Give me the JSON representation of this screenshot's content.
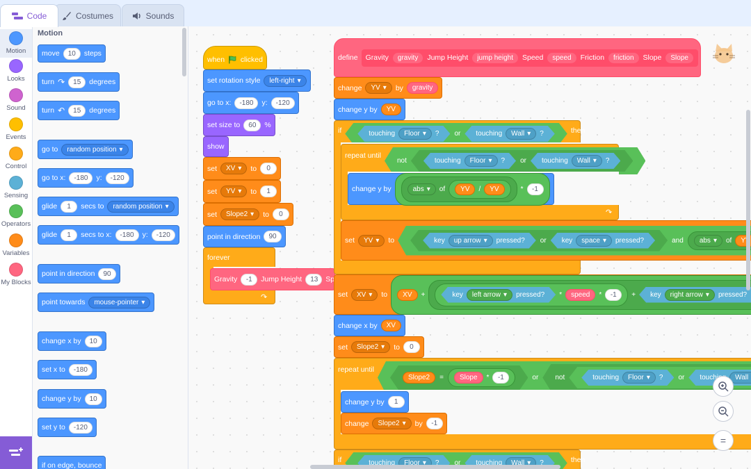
{
  "tabs": [
    {
      "label": "Code",
      "icon": "code-icon",
      "active": true
    },
    {
      "label": "Costumes",
      "icon": "brush-icon",
      "active": false
    },
    {
      "label": "Sounds",
      "icon": "speaker-icon",
      "active": false
    }
  ],
  "categories": [
    {
      "label": "Motion",
      "color": "#4c97ff"
    },
    {
      "label": "Looks",
      "color": "#9966ff"
    },
    {
      "label": "Sound",
      "color": "#cf63cf"
    },
    {
      "label": "Events",
      "color": "#ffbf00"
    },
    {
      "label": "Control",
      "color": "#ffab19"
    },
    {
      "label": "Sensing",
      "color": "#5cb1d6"
    },
    {
      "label": "Operators",
      "color": "#59c059"
    },
    {
      "label": "Variables",
      "color": "#ff8c1a"
    },
    {
      "label": "My Blocks",
      "color": "#ff6680"
    }
  ],
  "palette": {
    "title": "Motion",
    "move": {
      "a": "move",
      "v": "10",
      "b": "steps"
    },
    "turn_right": {
      "a": "turn",
      "v": "15",
      "b": "degrees"
    },
    "turn_left": {
      "a": "turn",
      "v": "15",
      "b": "degrees"
    },
    "goto": {
      "a": "go to",
      "dd": "random position"
    },
    "goto_xy": {
      "a": "go to x:",
      "x": "-180",
      "b": "y:",
      "y": "-120"
    },
    "glide_to": {
      "a": "glide",
      "v": "1",
      "b": "secs to",
      "dd": "random position"
    },
    "glide_xy": {
      "a": "glide",
      "v": "1",
      "b": "secs to x:",
      "x": "-180",
      "c": "y:",
      "y": "-120"
    },
    "point_dir": {
      "a": "point in direction",
      "v": "90"
    },
    "point_towards": {
      "a": "point towards",
      "dd": "mouse-pointer"
    },
    "change_x": {
      "a": "change x by",
      "v": "10"
    },
    "set_x": {
      "a": "set x to",
      "v": "-180"
    },
    "change_y": {
      "a": "change y by",
      "v": "10"
    },
    "set_y": {
      "a": "set y to",
      "v": "-120"
    },
    "edge_bounce": {
      "a": "if on edge, bounce"
    }
  },
  "script1": {
    "hat": {
      "a": "when",
      "b": "clicked"
    },
    "rotation": {
      "a": "set rotation style",
      "dd": "left-right"
    },
    "goto": {
      "a": "go to x:",
      "x": "-180",
      "b": "y:",
      "y": "-120"
    },
    "size": {
      "a": "set size to",
      "v": "60",
      "b": "%"
    },
    "show": "show",
    "set_xv": {
      "a": "set",
      "dd": "XV",
      "b": "to",
      "v": "0"
    },
    "set_yv": {
      "a": "set",
      "dd": "YV",
      "b": "to",
      "v": "1"
    },
    "set_slope2": {
      "a": "set",
      "dd": "Slope2",
      "b": "to",
      "v": "0"
    },
    "point": {
      "a": "point in direction",
      "v": "90"
    },
    "forever": "forever",
    "call": {
      "a": "Gravity",
      "g": "-1",
      "b": "Jump Height",
      "jh": "13",
      "c": "Sp"
    }
  },
  "script2": {
    "define": {
      "a": "define",
      "b": "Gravity",
      "p1": "gravity",
      "c": "Jump Height",
      "p2": "jump height",
      "d": "Speed",
      "p3": "speed",
      "e": "Friction",
      "p4": "friction",
      "f": "Slope",
      "p5": "Slope"
    },
    "change_yv": {
      "a": "change",
      "dd": "YV",
      "b": "by",
      "p": "gravity"
    },
    "change_y_yv": {
      "a": "change y by",
      "r": "YV"
    },
    "if1": {
      "a": "if",
      "t1": "touching",
      "d1": "Floor",
      "q1": "?",
      "or": "or",
      "t2": "touching",
      "d2": "Wall",
      "q2": "?",
      "b": "then"
    },
    "repeat1": {
      "a": "repeat until",
      "not": "not",
      "t1": "touching",
      "d1": "Floor",
      "q1": "?",
      "or": "or",
      "t2": "touching",
      "d2": "Wall",
      "q2": "?"
    },
    "change_y_abs": {
      "a": "change y by",
      "fn": "abs",
      "of": "of",
      "r1": "YV",
      "div": "/",
      "r2": "YV",
      "mul": "*",
      "v": "-1"
    },
    "set_yv_key": {
      "a": "set",
      "dd": "YV",
      "b": "to",
      "k1": "key",
      "d1": "up arrow",
      "p1": "pressed?",
      "or": "or",
      "k2": "key",
      "d2": "space",
      "p2": "pressed?",
      "and": "and",
      "fn": "abs",
      "of": "of",
      "r": "YV"
    },
    "set_xv": {
      "a": "set",
      "dd": "XV",
      "b": "to",
      "r": "XV",
      "plus": "+",
      "k1": "key",
      "d1": "left arrow",
      "p1": "pressed?",
      "mul1": "*",
      "sp": "speed",
      "mul2": "*",
      "v": "-1",
      "plus2": "+",
      "k2": "key",
      "d2": "right arrow",
      "p2": "pressed?"
    },
    "change_x": {
      "a": "change x by",
      "r": "XV"
    },
    "set_slope2": {
      "a": "set",
      "dd": "Slope2",
      "b": "to",
      "v": "0"
    },
    "repeat2": {
      "a": "repeat until",
      "r": "Slope2",
      "eq": "=",
      "p": "Slope",
      "mul": "*",
      "v": "-1",
      "or": "or",
      "not": "not",
      "t1": "touching",
      "d1": "Floor",
      "q1": "?",
      "or2": "or",
      "t2": "touching",
      "d2": "Wall",
      "q2": "?"
    },
    "change_y_1": {
      "a": "change y by",
      "v": "1"
    },
    "change_slope2": {
      "a": "change",
      "dd": "Slope2",
      "b": "by",
      "v": "-1"
    },
    "if2": {
      "a": "if",
      "t1": "touching",
      "d1": "Floor",
      "q1": "?",
      "or": "or",
      "t2": "touching",
      "d2": "Wall",
      "q2": "?",
      "b": "then"
    }
  },
  "zoom": {
    "in": "+",
    "out": "−",
    "reset": "="
  }
}
